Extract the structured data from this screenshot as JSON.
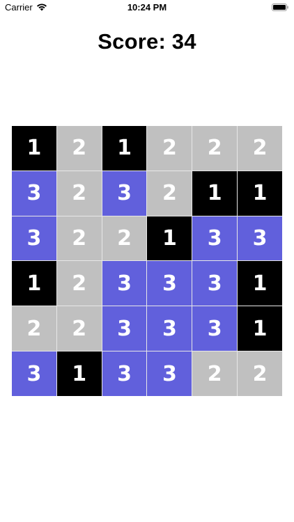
{
  "status_bar": {
    "carrier": "Carrier",
    "time": "10:24 PM",
    "wifi_icon": "wifi-icon",
    "battery_icon": "battery-icon"
  },
  "score": {
    "label": "Score: 34"
  },
  "colors": {
    "1": "#000000",
    "2": "#c0c0c0",
    "3": "#6160dc"
  },
  "board": {
    "rows": [
      [
        "1",
        "2",
        "1",
        "2",
        "2",
        "2"
      ],
      [
        "3",
        "2",
        "3",
        "2",
        "1",
        "1"
      ],
      [
        "3",
        "2",
        "2",
        "1",
        "3",
        "3"
      ],
      [
        "1",
        "2",
        "3",
        "3",
        "3",
        "1"
      ],
      [
        "2",
        "2",
        "3",
        "3",
        "3",
        "1"
      ],
      [
        "3",
        "1",
        "3",
        "3",
        "2",
        "2"
      ]
    ]
  }
}
